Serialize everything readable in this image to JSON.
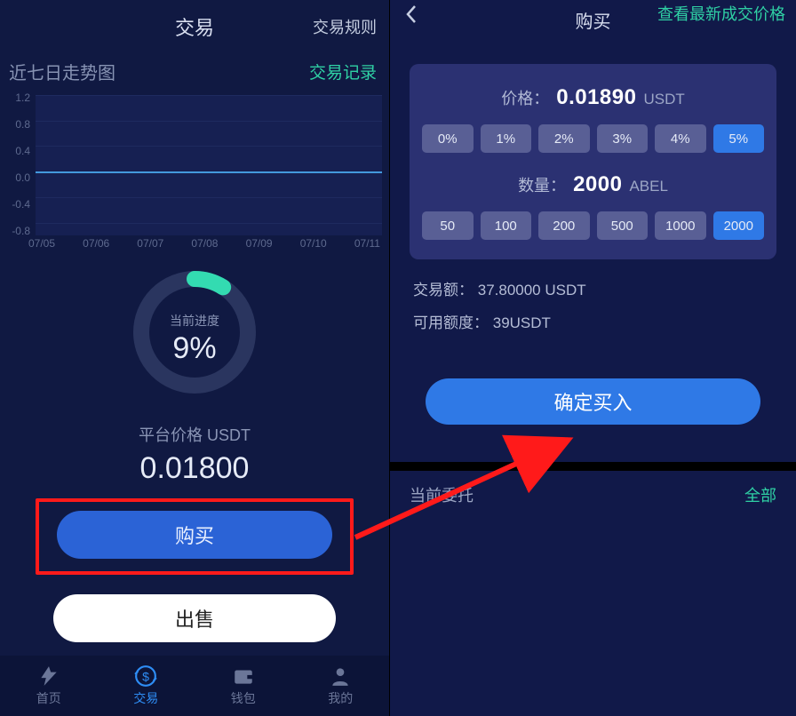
{
  "left": {
    "header_title": "交易",
    "rules_link": "交易规则",
    "chart_title": "近七日走势图",
    "record_link": "交易记录",
    "progress_label": "当前进度",
    "progress_value": "9%",
    "progress_percent": 9,
    "platform_price_label": "平台价格 USDT",
    "platform_price_value": "0.01800",
    "buy_label": "购买",
    "sell_label": "出售",
    "nav": [
      {
        "label": "首页",
        "icon": "home"
      },
      {
        "label": "交易",
        "icon": "trade"
      },
      {
        "label": "钱包",
        "icon": "wallet"
      },
      {
        "label": "我的",
        "icon": "profile"
      }
    ],
    "nav_active_index": 1
  },
  "right": {
    "header_title": "购买",
    "latest_link": "查看最新成交价格",
    "price_label": "价格：",
    "price_value": "0.01890",
    "price_unit": "USDT",
    "percent_options": [
      "0%",
      "1%",
      "2%",
      "3%",
      "4%",
      "5%"
    ],
    "percent_selected": "5%",
    "qty_label": "数量：",
    "qty_value": "2000",
    "qty_unit": "ABEL",
    "qty_options": [
      "50",
      "100",
      "200",
      "500",
      "1000",
      "2000"
    ],
    "qty_selected": "2000",
    "trade_amount_label": "交易额：",
    "trade_amount_value": "37.80000 USDT",
    "available_label": "可用额度：",
    "available_value": "39USDT",
    "confirm_label": "确定买入",
    "orders_title": "当前委托",
    "all_link": "全部"
  },
  "chart_data": {
    "type": "line",
    "title": "近七日走势图",
    "xlabel": "",
    "ylabel": "",
    "ylim": [
      -1.0,
      1.2
    ],
    "categories": [
      "07/05",
      "07/06",
      "07/07",
      "07/08",
      "07/09",
      "07/10",
      "07/11"
    ],
    "y_ticks": [
      1.2,
      0.8,
      0.4,
      0.0,
      -0.4,
      -0.8
    ],
    "series": [
      {
        "name": "price",
        "values": [
          0,
          0,
          0,
          0,
          0,
          0,
          0
        ]
      }
    ]
  }
}
